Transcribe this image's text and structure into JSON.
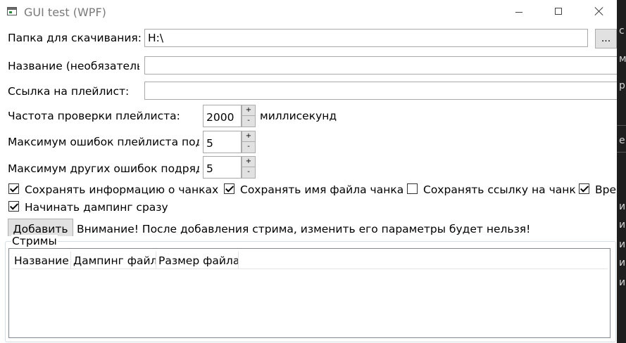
{
  "window": {
    "title": "GUI test (WPF)"
  },
  "form": {
    "download_folder_label": "Папка для скачивания:",
    "download_folder_value": "H:\\",
    "browse_button": "...",
    "name_label": "Название (необязательно):",
    "name_value": "",
    "playlist_url_label": "Ссылка на плейлист:",
    "playlist_url_value": "",
    "check_interval_label": "Частота проверки плейлиста:",
    "check_interval_value": "2000",
    "check_interval_unit": "миллисекунд",
    "max_playlist_errors_label": "Максимум ошибок плейлиста подряд:",
    "max_playlist_errors_value": "5",
    "max_other_errors_label": "Максимум других ошибок подряд:",
    "max_other_errors_value": "5",
    "spin_up": "+",
    "spin_down": "-"
  },
  "checkboxes": [
    {
      "label": "Сохранять информацию о чанках",
      "checked": true
    },
    {
      "label": "Сохранять имя файла чанка",
      "checked": true
    },
    {
      "label": "Сохранять ссылку на чанк",
      "checked": false
    },
    {
      "label": "Время",
      "checked": true
    },
    {
      "label": "Начинать дампинг сразу",
      "checked": true
    }
  ],
  "add_button": "Добавить",
  "warning_text": "Внимание! После добавления стрима, изменить его параметры будет нельзя!",
  "streams_group": {
    "title": "Стримы",
    "columns": [
      "Название",
      "Дампинг файл",
      "Размер файла"
    ]
  },
  "background_glyphs": [
    "с",
    "м",
    "р",
    "е",
    "и",
    "и",
    "и",
    "и",
    "и"
  ]
}
